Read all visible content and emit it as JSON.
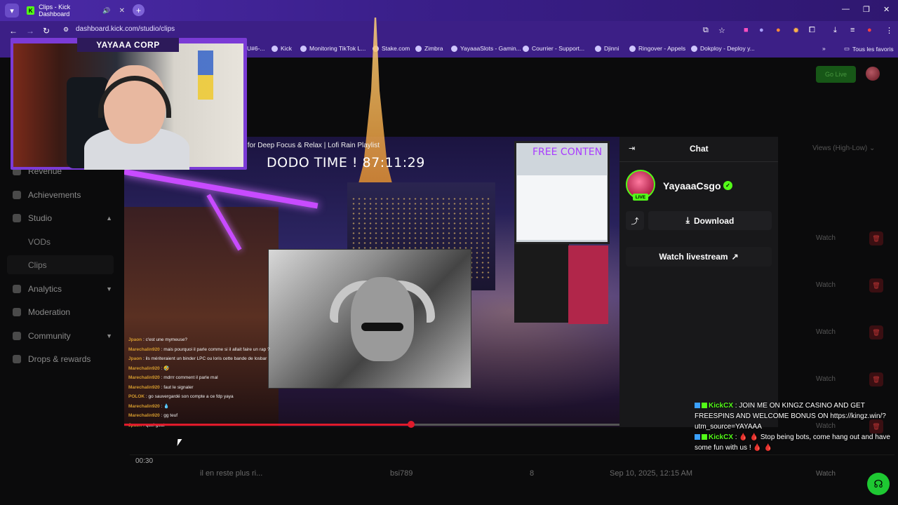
{
  "browser": {
    "tab_title": "Clips - Kick Dashboard",
    "url": "dashboard.kick.com/studio/clips",
    "bookmarks": [
      "U#6-...",
      "Kick",
      "Monitoring TikTok L...",
      "Stake.com",
      "Zimbra",
      "YayaaaSlots - Gamin...",
      "Courrier - Support...",
      "Djinni",
      "Ringover - Appels",
      "Dokploy - Deploy y..."
    ],
    "all_bookmarks": "Tous les favoris"
  },
  "header": {
    "go_live": "Go Live"
  },
  "sidebar": {
    "items": [
      {
        "label": "Revenue"
      },
      {
        "label": "Achievements"
      },
      {
        "label": "Studio"
      },
      {
        "label": "VODs"
      },
      {
        "label": "Clips"
      },
      {
        "label": "Analytics"
      },
      {
        "label": "Moderation"
      },
      {
        "label": "Community"
      },
      {
        "label": "Drops & rewards"
      }
    ]
  },
  "table": {
    "sort_label": "Views (High-Low)",
    "watch_label": "Watch",
    "last_row": {
      "duration": "00:30",
      "title": "il en reste plus ri...",
      "creator": "bsi789",
      "views": "8",
      "date": "Sep 10, 2025, 12:15 AM",
      "action": "Watch"
    }
  },
  "video": {
    "facecam_banner": "YAYAAA CORP",
    "stream_title": "c for Deep Focus & Relax | Lofi Rain Playlist",
    "dodo_time": "DODO TIME !   87:11:29",
    "free_content": "FREE  CONTEN",
    "progress": 0.58,
    "overlay_chat": [
      {
        "user": "Jpaon",
        "text": "c'est une mymeuse?"
      },
      {
        "user": "Marechalin920",
        "text": "mais pourquoi il parle comme si il allait faire un rap ?"
      },
      {
        "user": "Jpaon",
        "text": "ils mériteraient un binder LPC ou loris cette bande de losbar"
      },
      {
        "user": "Marechalin920",
        "text": "🤣"
      },
      {
        "user": "Marechalin920",
        "text": "mdrrr comment il parle mal"
      },
      {
        "user": "Marechalin920",
        "text": "faut le signaler"
      },
      {
        "user": "POLOK",
        "text": "go sauvergardé son compte a ce fdp yaya"
      },
      {
        "user": "Marechalin920",
        "text": "💧"
      },
      {
        "user": "Marechalin920",
        "text": "gg teuf"
      },
      {
        "user": "Jpaon",
        "text": "quel goat"
      }
    ]
  },
  "panel": {
    "title": "Chat",
    "streamer": "YayaaaCsgo",
    "live_label": "LIVE",
    "download_label": "Download",
    "watch_livestream_label": "Watch livestream"
  },
  "live_chat": [
    {
      "user": "KickCX",
      "text": "JOIN ME ON KINGZ CASINO AND GET FREESPINS AND WELCOME BONUS ON https://kingz.win/?utm_source=YAYAAA"
    },
    {
      "user": "KickCX",
      "text": "🩸 🩸  Stop being bots, come hang out and have some fun with us ! 🩸 🩸"
    }
  ],
  "colors": {
    "kick_green": "#53fc18",
    "browser_purple": "#3c1f86",
    "panel_bg": "#18181a",
    "danger": "#e01a2b"
  }
}
